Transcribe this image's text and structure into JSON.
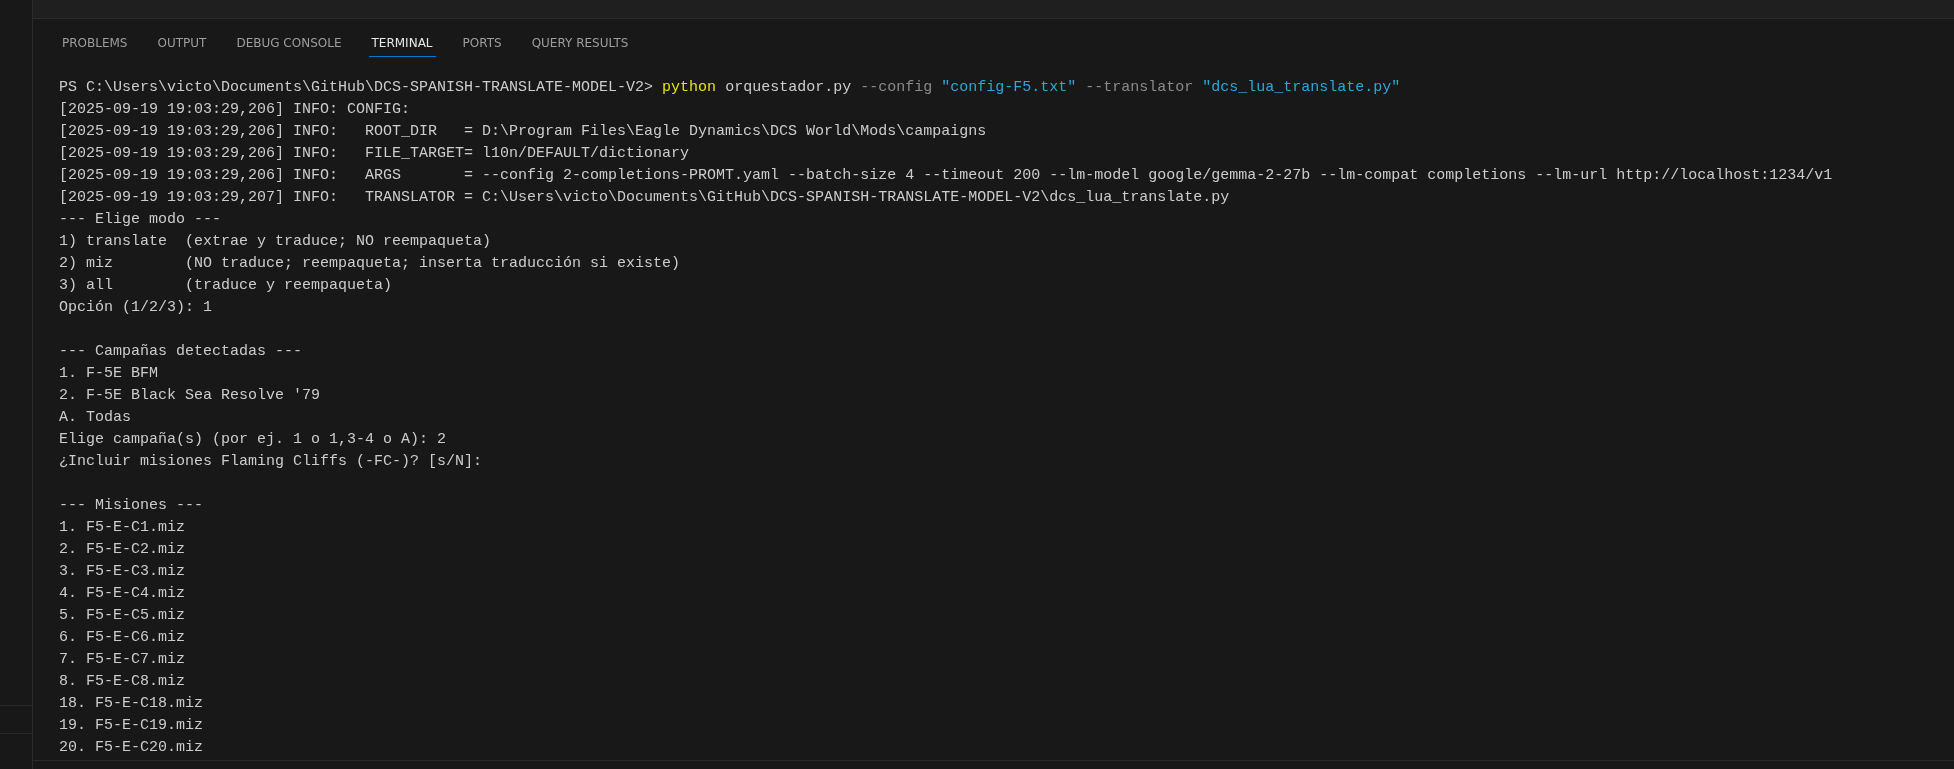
{
  "panel_tabs": [
    {
      "label": "PROBLEMS",
      "selected": false
    },
    {
      "label": "OUTPUT",
      "selected": false
    },
    {
      "label": "DEBUG CONSOLE",
      "selected": false
    },
    {
      "label": "TERMINAL",
      "selected": true
    },
    {
      "label": "PORTS",
      "selected": false
    },
    {
      "label": "QUERY RESULTS",
      "selected": false
    }
  ],
  "terminal": {
    "lines": [
      {
        "kind": "text",
        "segments": [
          {
            "kind": "plain",
            "text": "PS C:\\Users\\victo\\Documents\\GitHub\\DCS-SPANISH-TRANSLATE-MODEL-V2> "
          },
          {
            "kind": "command",
            "text": "python"
          },
          {
            "kind": "plain",
            "text": " orquestador.py "
          },
          {
            "kind": "arg",
            "text": "--config "
          },
          {
            "kind": "string",
            "text": "\"config-F5.txt\" "
          },
          {
            "kind": "arg",
            "text": "--translator "
          },
          {
            "kind": "string",
            "text": "\"dcs_lua_translate.py\""
          }
        ]
      },
      {
        "kind": "text",
        "segments": [
          {
            "kind": "plain",
            "text": "[2025-09-19 19:03:29,206] INFO: CONFIG:"
          }
        ]
      },
      {
        "kind": "text",
        "segments": [
          {
            "kind": "plain",
            "text": "[2025-09-19 19:03:29,206] INFO:   ROOT_DIR   = D:\\Program Files\\Eagle Dynamics\\DCS World\\Mods\\campaigns"
          }
        ]
      },
      {
        "kind": "text",
        "segments": [
          {
            "kind": "plain",
            "text": "[2025-09-19 19:03:29,206] INFO:   FILE_TARGET= l10n/DEFAULT/dictionary"
          }
        ]
      },
      {
        "kind": "text",
        "segments": [
          {
            "kind": "plain",
            "text": "[2025-09-19 19:03:29,206] INFO:   ARGS       = --config 2-completions-PROMT.yaml --batch-size 4 --timeout 200 --lm-model google/gemma-2-27b --lm-compat completions --lm-url http://localhost:1234/v1"
          }
        ]
      },
      {
        "kind": "text",
        "segments": [
          {
            "kind": "plain",
            "text": "[2025-09-19 19:03:29,207] INFO:   TRANSLATOR = C:\\Users\\victo\\Documents\\GitHub\\DCS-SPANISH-TRANSLATE-MODEL-V2\\dcs_lua_translate.py"
          }
        ]
      },
      {
        "kind": "text",
        "segments": [
          {
            "kind": "plain",
            "text": "--- Elige modo ---"
          }
        ]
      },
      {
        "kind": "text",
        "segments": [
          {
            "kind": "plain",
            "text": "1) translate  (extrae y traduce; NO reempaqueta)"
          }
        ]
      },
      {
        "kind": "text",
        "segments": [
          {
            "kind": "plain",
            "text": "2) miz        (NO traduce; reempaqueta; inserta traducción si existe)"
          }
        ]
      },
      {
        "kind": "text",
        "segments": [
          {
            "kind": "plain",
            "text": "3) all        (traduce y reempaqueta)"
          }
        ]
      },
      {
        "kind": "text",
        "segments": [
          {
            "kind": "plain",
            "text": "Opción (1/2/3): 1"
          }
        ]
      },
      {
        "kind": "blank"
      },
      {
        "kind": "text",
        "segments": [
          {
            "kind": "plain",
            "text": "--- Campañas detectadas ---"
          }
        ]
      },
      {
        "kind": "text",
        "segments": [
          {
            "kind": "plain",
            "text": "1. F-5E BFM"
          }
        ]
      },
      {
        "kind": "text",
        "segments": [
          {
            "kind": "plain",
            "text": "2. F-5E Black Sea Resolve '79"
          }
        ]
      },
      {
        "kind": "text",
        "segments": [
          {
            "kind": "plain",
            "text": "A. Todas"
          }
        ]
      },
      {
        "kind": "text",
        "segments": [
          {
            "kind": "plain",
            "text": "Elige campaña(s) (por ej. 1 o 1,3-4 o A): 2"
          }
        ]
      },
      {
        "kind": "text",
        "segments": [
          {
            "kind": "plain",
            "text": "¿Incluir misiones Flaming Cliffs (-FC-)? [s/N]:"
          }
        ]
      },
      {
        "kind": "blank"
      },
      {
        "kind": "text",
        "segments": [
          {
            "kind": "plain",
            "text": "--- Misiones ---"
          }
        ]
      },
      {
        "kind": "text",
        "segments": [
          {
            "kind": "plain",
            "text": "1. F5-E-C1.miz"
          }
        ]
      },
      {
        "kind": "text",
        "segments": [
          {
            "kind": "plain",
            "text": "2. F5-E-C2.miz"
          }
        ]
      },
      {
        "kind": "text",
        "segments": [
          {
            "kind": "plain",
            "text": "3. F5-E-C3.miz"
          }
        ]
      },
      {
        "kind": "text",
        "segments": [
          {
            "kind": "plain",
            "text": "4. F5-E-C4.miz"
          }
        ]
      },
      {
        "kind": "text",
        "segments": [
          {
            "kind": "plain",
            "text": "5. F5-E-C5.miz"
          }
        ]
      },
      {
        "kind": "text",
        "segments": [
          {
            "kind": "plain",
            "text": "6. F5-E-C6.miz"
          }
        ]
      },
      {
        "kind": "text",
        "segments": [
          {
            "kind": "plain",
            "text": "7. F5-E-C7.miz"
          }
        ]
      },
      {
        "kind": "text",
        "segments": [
          {
            "kind": "plain",
            "text": "8. F5-E-C8.miz"
          }
        ]
      },
      {
        "kind": "text",
        "segments": [
          {
            "kind": "plain",
            "text": "18. F5-E-C18.miz"
          }
        ]
      },
      {
        "kind": "text",
        "segments": [
          {
            "kind": "plain",
            "text": "19. F5-E-C19.miz"
          }
        ]
      },
      {
        "kind": "text",
        "segments": [
          {
            "kind": "plain",
            "text": "20. F5-E-C20.miz"
          }
        ]
      }
    ]
  }
}
